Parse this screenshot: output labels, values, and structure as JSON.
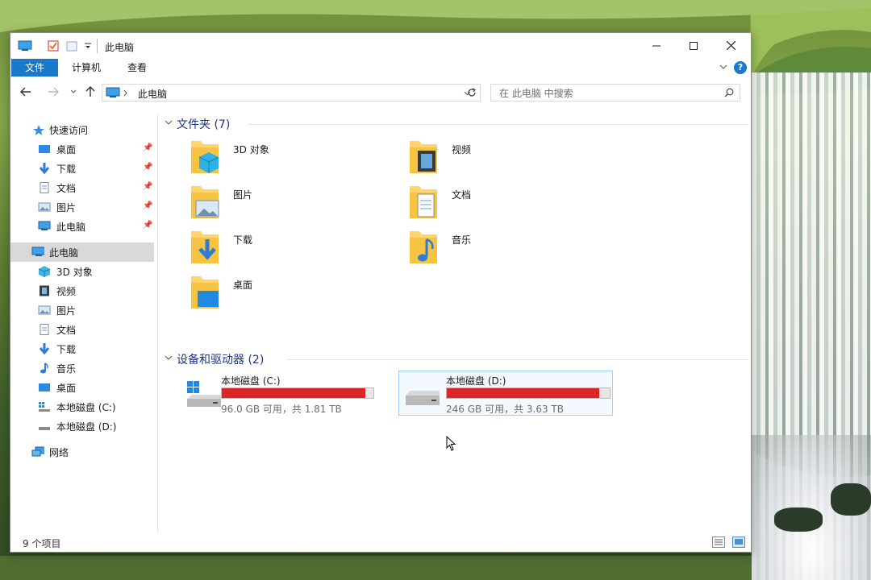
{
  "colors": {
    "accent": "#1979ca",
    "capacity_bar": "#da2626",
    "group_header": "#1e3287"
  },
  "titlebar": {
    "title": "此电脑",
    "minimize_icon": "minimize-icon",
    "maximize_icon": "maximize-icon",
    "close_icon": "close-icon"
  },
  "ribbon": {
    "tabs": [
      "文件",
      "计算机",
      "查看"
    ],
    "help": "?"
  },
  "address": {
    "path_item": "此电脑"
  },
  "search": {
    "placeholder": "在 此电脑 中搜索"
  },
  "sidebar": {
    "quick_access": "快速访问",
    "quick_items": [
      {
        "label": "桌面",
        "icon": "desktop-icon"
      },
      {
        "label": "下载",
        "icon": "download-icon"
      },
      {
        "label": "文档",
        "icon": "document-icon"
      },
      {
        "label": "图片",
        "icon": "pictures-icon"
      },
      {
        "label": "此电脑",
        "icon": "computer-icon"
      }
    ],
    "this_pc": "此电脑",
    "pc_items": [
      {
        "label": "3D 对象",
        "icon": "3d-objects-icon"
      },
      {
        "label": "视频",
        "icon": "video-icon"
      },
      {
        "label": "图片",
        "icon": "pictures-icon"
      },
      {
        "label": "文档",
        "icon": "document-icon"
      },
      {
        "label": "下载",
        "icon": "download-icon"
      },
      {
        "label": "音乐",
        "icon": "music-icon"
      },
      {
        "label": "桌面",
        "icon": "desktop-icon"
      },
      {
        "label": "本地磁盘 (C:)",
        "icon": "drive-c-icon"
      },
      {
        "label": "本地磁盘 (D:)",
        "icon": "drive-d-icon"
      }
    ],
    "network": "网络"
  },
  "folders_group": {
    "header": "文件夹 (7)",
    "items": [
      {
        "label": "3D 对象",
        "icon": "3d-objects-folder-icon"
      },
      {
        "label": "视频",
        "icon": "video-folder-icon"
      },
      {
        "label": "图片",
        "icon": "pictures-folder-icon"
      },
      {
        "label": "文档",
        "icon": "documents-folder-icon"
      },
      {
        "label": "下载",
        "icon": "downloads-folder-icon"
      },
      {
        "label": "音乐",
        "icon": "music-folder-icon"
      },
      {
        "label": "桌面",
        "icon": "desktop-folder-icon"
      }
    ]
  },
  "drives_group": {
    "header": "设备和驱动器 (2)",
    "drives": [
      {
        "name": "本地磁盘 (C:)",
        "free_text": "96.0 GB 可用，共 1.81 TB",
        "used_fraction": 0.948
      },
      {
        "name": "本地磁盘 (D:)",
        "free_text": "246 GB 可用，共 3.63 TB",
        "used_fraction": 0.934
      }
    ]
  },
  "status": {
    "item_count": "9 个项目"
  }
}
